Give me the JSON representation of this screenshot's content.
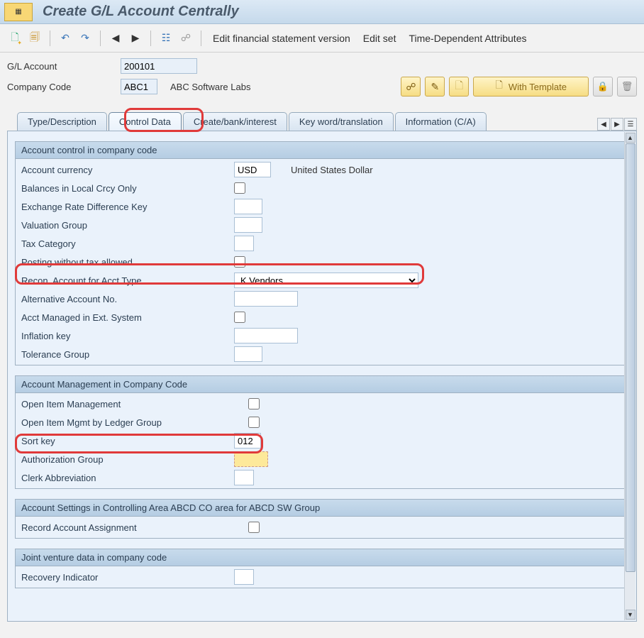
{
  "title": "Create G/L Account Centrally",
  "toolbar": {
    "links": [
      "Edit financial statement version",
      "Edit set",
      "Time-Dependent Attributes"
    ]
  },
  "header": {
    "gl_account_label": "G/L Account",
    "gl_account_value": "200101",
    "company_code_label": "Company Code",
    "company_code_value": "ABC1",
    "company_code_desc": "ABC Software Labs",
    "with_template_label": "With Template"
  },
  "tabs": [
    "Type/Description",
    "Control Data",
    "Create/bank/interest",
    "Key word/translation",
    "Information (C/A)"
  ],
  "active_tab": 1,
  "groups": {
    "g1": {
      "title": "Account control in company code",
      "rows": {
        "currency_lbl": "Account currency",
        "currency_val": "USD",
        "currency_desc": "United States Dollar",
        "bal_local_lbl": "Balances in Local Crcy Only",
        "exch_rate_lbl": "Exchange Rate Difference Key",
        "valuation_lbl": "Valuation Group",
        "tax_cat_lbl": "Tax Category",
        "post_notax_lbl": "Posting without tax allowed",
        "recon_lbl": "Recon. Account for Acct Type",
        "recon_val": "K Vendors",
        "alt_acct_lbl": "Alternative Account No.",
        "ext_sys_lbl": "Acct Managed in Ext. System",
        "inflation_lbl": "Inflation key",
        "tolerance_lbl": "Tolerance Group"
      }
    },
    "g2": {
      "title": "Account Management in Company Code",
      "rows": {
        "open_item_lbl": "Open Item Management",
        "open_item_lg_lbl": "Open Item Mgmt by Ledger Group",
        "sort_key_lbl": "Sort key",
        "sort_key_val": "012",
        "auth_group_lbl": "Authorization Group",
        "auth_group_val": "",
        "clerk_lbl": "Clerk Abbreviation"
      }
    },
    "g3": {
      "title": "Account Settings in Controlling Area ABCD CO area for ABCD SW Group",
      "rows": {
        "rec_assign_lbl": "Record Account Assignment"
      }
    },
    "g4": {
      "title": "Joint venture data in company code",
      "rows": {
        "recovery_lbl": "Recovery Indicator"
      }
    }
  }
}
